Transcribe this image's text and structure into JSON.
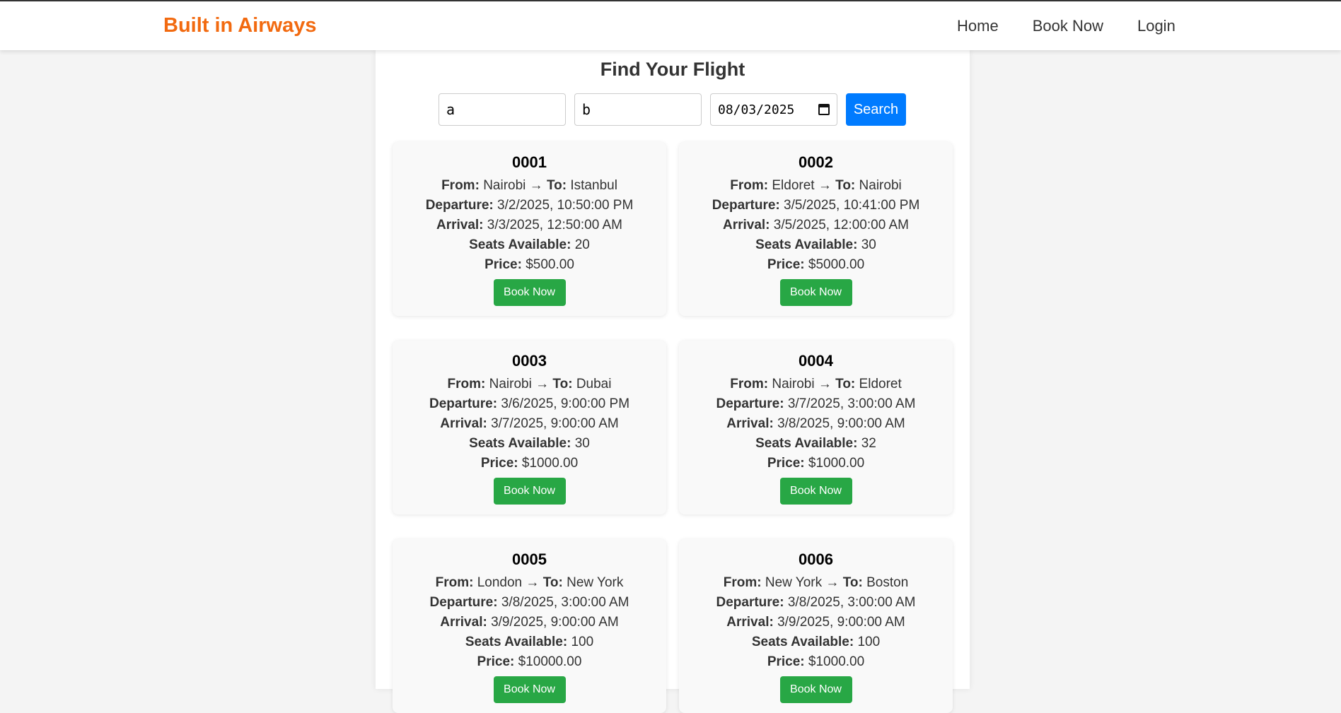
{
  "brand": "Built in Airways",
  "nav": [
    {
      "label": "Home"
    },
    {
      "label": "Book Now"
    },
    {
      "label": "Login"
    }
  ],
  "page_title": "Find Your Flight",
  "search": {
    "origin_value": "a",
    "destination_value": "b",
    "date_value": "08/03/2025",
    "button_label": "Search"
  },
  "labels": {
    "from": "From:",
    "to": "To:",
    "arrow": "→",
    "departure": "Departure:",
    "arrival": "Arrival:",
    "seats": "Seats Available:",
    "price": "Price:",
    "book": "Book Now"
  },
  "flights": [
    {
      "id": "0001",
      "from": "Nairobi",
      "to": "Istanbul",
      "departure": "3/2/2025, 10:50:00 PM",
      "arrival": "3/3/2025, 12:50:00 AM",
      "seats": "20",
      "price": "$500.00"
    },
    {
      "id": "0002",
      "from": "Eldoret",
      "to": "Nairobi",
      "departure": "3/5/2025, 10:41:00 PM",
      "arrival": "3/5/2025, 12:00:00 AM",
      "seats": "30",
      "price": "$5000.00"
    },
    {
      "id": "0003",
      "from": "Nairobi",
      "to": "Dubai",
      "departure": "3/6/2025, 9:00:00 PM",
      "arrival": "3/7/2025, 9:00:00 AM",
      "seats": "30",
      "price": "$1000.00"
    },
    {
      "id": "0004",
      "from": "Nairobi",
      "to": "Eldoret",
      "departure": "3/7/2025, 3:00:00 AM",
      "arrival": "3/8/2025, 9:00:00 AM",
      "seats": "32",
      "price": "$1000.00"
    },
    {
      "id": "0005",
      "from": "London",
      "to": "New York",
      "departure": "3/8/2025, 3:00:00 AM",
      "arrival": "3/9/2025, 9:00:00 AM",
      "seats": "100",
      "price": "$10000.00"
    },
    {
      "id": "0006",
      "from": "New York",
      "to": "Boston",
      "departure": "3/8/2025, 3:00:00 AM",
      "arrival": "3/9/2025, 9:00:00 AM",
      "seats": "100",
      "price": "$1000.00"
    }
  ]
}
